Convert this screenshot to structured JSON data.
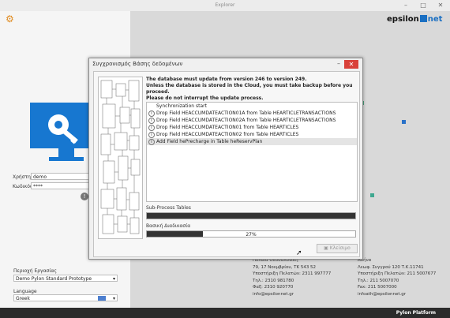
{
  "window": {
    "title": "Explorer",
    "minimize": "–",
    "maximize": "□",
    "close": "✕"
  },
  "brand": {
    "name": "epsilon",
    "suffix": "net"
  },
  "login": {
    "user_label": "Χρήστης",
    "user_value": "demo",
    "code_label": "Κωδικός",
    "code_value": "****"
  },
  "workspace": {
    "area_label": "Περιοχή Εργασίας",
    "area_value": "Demo Pylon Standard Prototype",
    "language_label": "Language",
    "language_value": "Greek"
  },
  "dialog": {
    "title": "Συγχρονισμός Βάσης δεδομένων",
    "minimize": "–",
    "close": "✕",
    "warning_lines": [
      "The database must update from version 246 to version 249.",
      "Unless the database is stored in the Cloud, you must take backup before you proceed.",
      "Please do not interrupt the update process."
    ],
    "log": [
      {
        "text": "Synchronization start",
        "icon": ""
      },
      {
        "text": "Drop Field HEACCUMDATEACTION01A from Table HEARTICLETRANSACTIONS",
        "icon": "i"
      },
      {
        "text": "Drop Field HEACCUMDATEACTION02A from Table HEARTICLETRANSACTIONS",
        "icon": "i"
      },
      {
        "text": "Drop Field HEACCUMDATEACTION01 from Table HEARTICLES",
        "icon": "i"
      },
      {
        "text": "Drop Field HEACCUMDATEACTION02 from Table HEARTICLES",
        "icon": "i"
      },
      {
        "text": "Add Field hePrecharge in Table heReservPlan",
        "icon": "i"
      }
    ],
    "subprocess_label": "Sub-Process Tables",
    "subprocess_progress": 1.0,
    "main_label": "Βασική Διαδικασία",
    "main_progress_text": "27%",
    "main_progress": 0.27,
    "close_button": "Κλείσιμο"
  },
  "contacts": [
    {
      "lines": [
        "Πυλαία Θεσσαλονίκη",
        "79, 17 Νοεμβρίου, ΤΚ 543 52",
        "Υποστήριξη Πελατών: 2311 997777",
        "Τηλ.: 2310 981780",
        "Φαξ: 2310 920770",
        "info@epsilonnet.gr"
      ]
    },
    {
      "lines": [
        "Αθήνα",
        "Λεωφ. Συγγρού 120 Τ.Κ.11741",
        "Υποστήριξη Πελατών: 211 5007677",
        "Τηλ.: 211 5007070",
        "Fax: 211 5007000",
        "infoath@epsilonnet.gr"
      ]
    }
  ],
  "footer": {
    "text": "Pylon Platform"
  },
  "colors": {
    "accent": "#1a6fc2",
    "close_red": "#d9413a",
    "gear": "#e08a1e",
    "footer": "#2b2b2b"
  }
}
